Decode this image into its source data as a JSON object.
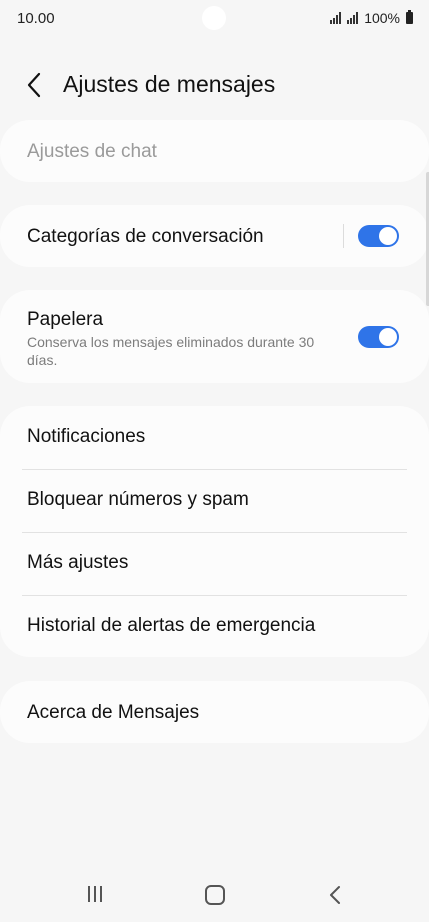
{
  "status": {
    "time": "10.00",
    "battery": "100%"
  },
  "header": {
    "title": "Ajustes de mensajes"
  },
  "chat_settings": {
    "label": "Ajustes de chat"
  },
  "conversation_categories": {
    "label": "Categorías de conversación",
    "enabled": true
  },
  "trash": {
    "label": "Papelera",
    "description": "Conserva los mensajes eliminados durante 30 días.",
    "enabled": true
  },
  "menu": [
    {
      "label": "Notificaciones"
    },
    {
      "label": "Bloquear números y spam"
    },
    {
      "label": "Más ajustes"
    },
    {
      "label": "Historial de alertas de emergencia"
    }
  ],
  "about": {
    "label": "Acerca de Mensajes"
  },
  "colors": {
    "accent": "#2f74e8",
    "background": "#f6f6f6",
    "card": "#fcfcfc"
  },
  "icons": [
    "back-icon",
    "signal-icon",
    "battery-icon",
    "recents-icon",
    "home-icon",
    "nav-back-icon"
  ]
}
